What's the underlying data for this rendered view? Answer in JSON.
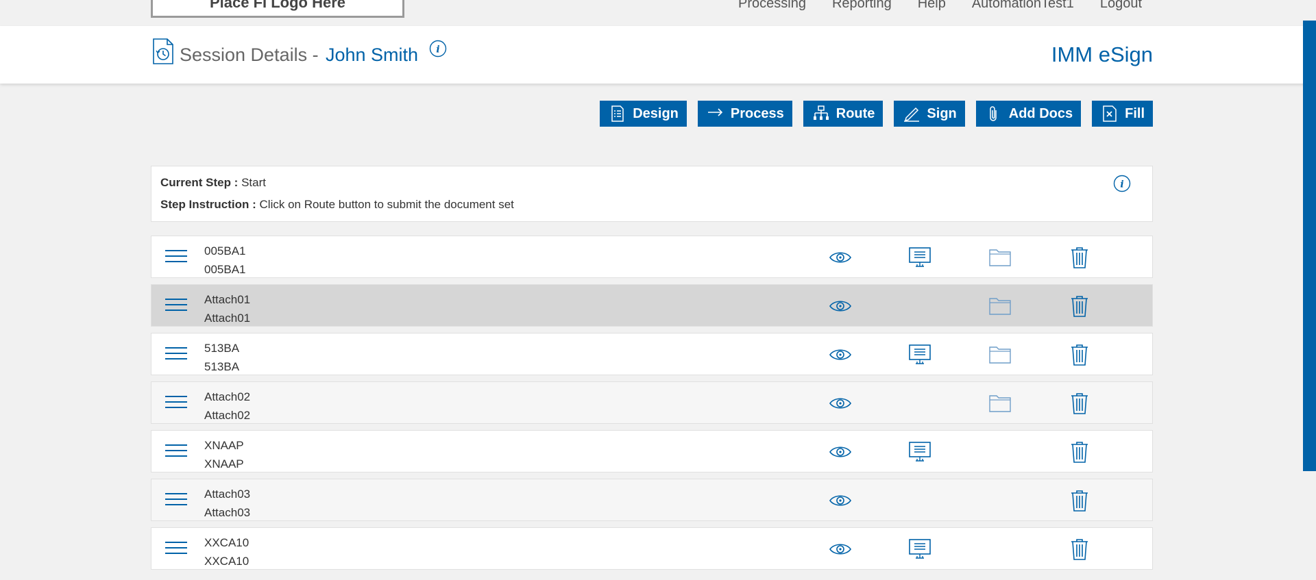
{
  "topbar": {
    "logo_text": "Place FI Logo Here",
    "nav": [
      "Processing",
      "Reporting",
      "Help",
      "AutomationTest1",
      "Logout"
    ]
  },
  "header": {
    "title": "Session Details -",
    "name": "John Smith",
    "brand": "IMM eSign"
  },
  "toolbar": {
    "buttons": [
      {
        "label": "Design",
        "icon": "checklist-icon"
      },
      {
        "label": "Process",
        "icon": "arrow-right-icon"
      },
      {
        "label": "Route",
        "icon": "hierarchy-icon"
      },
      {
        "label": "Sign",
        "icon": "pen-icon"
      },
      {
        "label": "Add Docs",
        "icon": "paperclip-icon"
      },
      {
        "label": "Fill",
        "icon": "form-icon"
      }
    ]
  },
  "step": {
    "current_label": "Current Step :",
    "current_value": "Start",
    "instruction_label": "Step Instruction :",
    "instruction_value": "Click on Route button to submit the document set"
  },
  "documents": [
    {
      "line1": "005BA1",
      "line2": "005BA1",
      "screen": true,
      "folder": true
    },
    {
      "line1": "Attach01",
      "line2": "Attach01",
      "screen": false,
      "folder": true
    },
    {
      "line1": "513BA",
      "line2": "513BA",
      "screen": true,
      "folder": true
    },
    {
      "line1": "Attach02",
      "line2": "Attach02",
      "screen": false,
      "folder": true
    },
    {
      "line1": "XNAAP",
      "line2": "XNAAP",
      "screen": true,
      "folder": false
    },
    {
      "line1": "Attach03",
      "line2": "Attach03",
      "screen": false,
      "folder": false
    },
    {
      "line1": "XXCA10",
      "line2": "XXCA10",
      "screen": true,
      "folder": false
    }
  ],
  "colors": {
    "accent": "#0062a8",
    "selected_row": "#d6d6d6"
  }
}
